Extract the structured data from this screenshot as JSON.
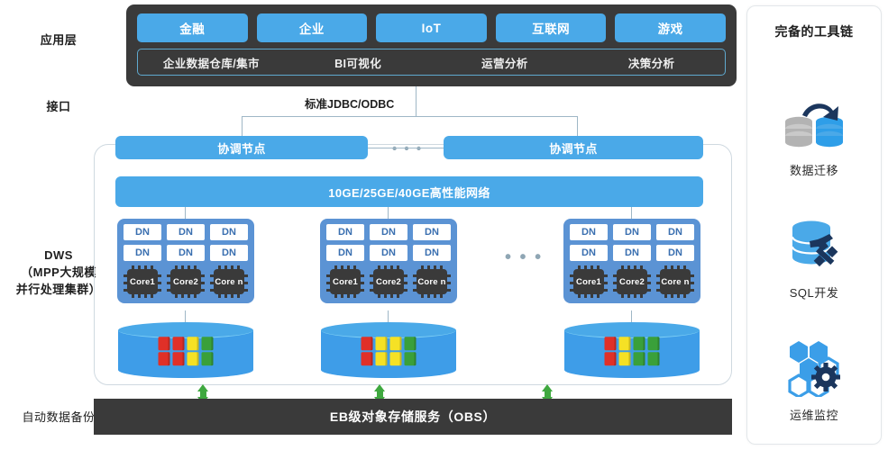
{
  "rows": {
    "application_layer": "应用层",
    "interface": "接口",
    "dws": "DWS\n（MPP大规模\n并行处理集群）",
    "dws_line1": "DWS",
    "dws_line2": "（MPP大规模",
    "dws_line3": "并行处理集群）",
    "backup": "自动数据备份"
  },
  "application": {
    "chips": [
      "金融",
      "企业",
      "IoT",
      "互联网",
      "游戏"
    ],
    "subitems": [
      "企业数据仓库/集市",
      "BI可视化",
      "运营分析",
      "决策分析"
    ]
  },
  "interface": {
    "protocol_label": "标准JDBC/ODBC"
  },
  "cluster": {
    "coordinator_left": "协调节点",
    "coordinator_right": "协调节点",
    "coordinator_ellipsis": "• • •",
    "network_bar": "10GE/25GE/40GE高性能网络",
    "node_ellipsis": "• • •",
    "dn_label": "DN",
    "dn_rows": 2,
    "dn_per_row": 3,
    "cores": [
      "Core1",
      "Core2",
      "Core n"
    ],
    "groups": [
      {
        "id": "group-1",
        "dn": [
          [
            "DN",
            "DN",
            "DN"
          ],
          [
            "DN",
            "DN",
            "DN"
          ]
        ],
        "cores": [
          "Core1",
          "Core2",
          "Core n"
        ],
        "storage_blocks": [
          {
            "color": "#e03028",
            "count": 2
          },
          {
            "color": "#e03028",
            "count": 2
          },
          {
            "color": "#f5e125",
            "count": 2
          },
          {
            "color": "#3aa03a",
            "count": 2
          }
        ]
      },
      {
        "id": "group-2",
        "dn": [
          [
            "DN",
            "DN",
            "DN"
          ],
          [
            "DN",
            "DN",
            "DN"
          ]
        ],
        "cores": [
          "Core1",
          "Core2",
          "Core n"
        ],
        "storage_blocks": [
          {
            "color": "#e03028",
            "count": 2
          },
          {
            "color": "#f5e125",
            "count": 2
          },
          {
            "color": "#f5e125",
            "count": 2
          },
          {
            "color": "#3aa03a",
            "count": 2
          }
        ]
      },
      {
        "id": "group-3",
        "dn": [
          [
            "DN",
            "DN",
            "DN"
          ],
          [
            "DN",
            "DN",
            "DN"
          ]
        ],
        "cores": [
          "Core1",
          "Core2",
          "Core n"
        ],
        "storage_blocks": [
          {
            "color": "#e03028",
            "count": 2
          },
          {
            "color": "#f5e125",
            "count": 2
          },
          {
            "color": "#3aa03a",
            "count": 2
          },
          {
            "color": "#3aa03a",
            "count": 2
          }
        ]
      }
    ]
  },
  "storage": {
    "obs_label": "EB级对象存储服务（OBS）"
  },
  "toolchain": {
    "title": "完备的工具链",
    "items": [
      {
        "icon": "data-migration-icon",
        "label": "数据迁移"
      },
      {
        "icon": "sql-development-icon",
        "label": "SQL开发"
      },
      {
        "icon": "operations-monitoring-icon",
        "label": "运维监控"
      }
    ]
  },
  "colors": {
    "accent_blue": "#4aa9e8",
    "node_blue": "#5b93d4",
    "dark_panel": "#3a3a3a",
    "arrow_green": "#3fa83f",
    "block_red": "#e03028",
    "block_yellow": "#f5e125",
    "block_green": "#3aa03a",
    "icon_navy": "#1b365d"
  }
}
